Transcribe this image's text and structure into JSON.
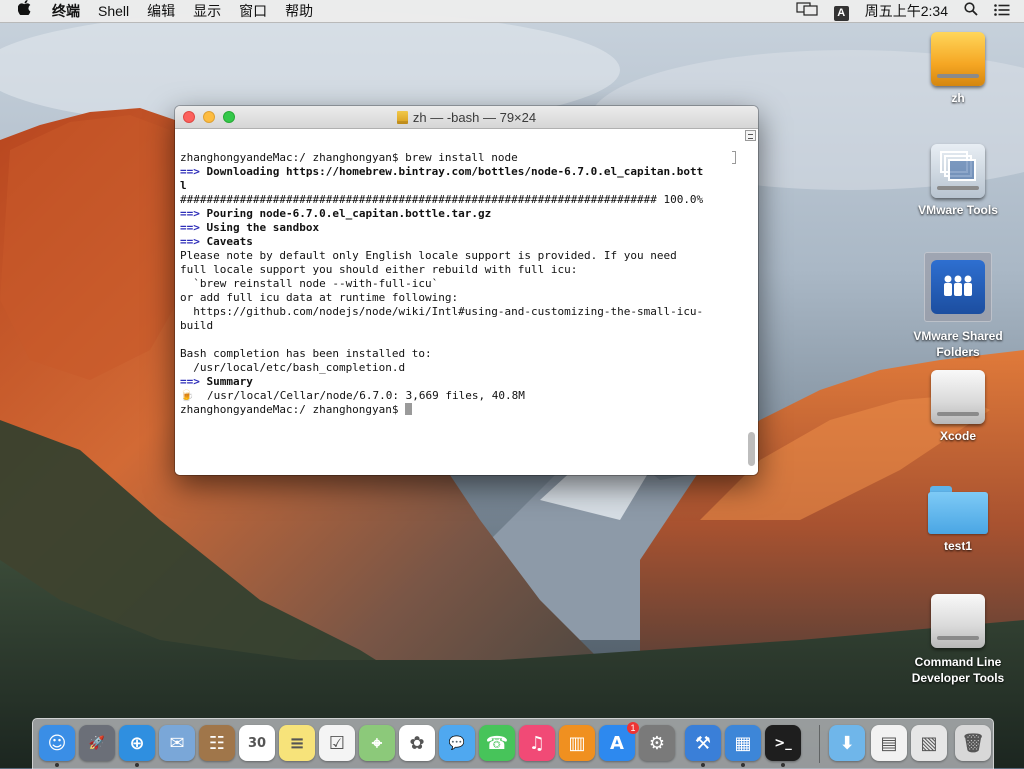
{
  "menubar": {
    "apple_icon": "apple-icon",
    "app_name": "终端",
    "menus": [
      "Shell",
      "编辑",
      "显示",
      "窗口",
      "帮助"
    ],
    "input_method": "A",
    "clock": "周五上午2:34"
  },
  "terminal": {
    "title": "zh — -bash — 79×24",
    "lines": [
      [
        {
          "t": "zhanghongyandeMac:/ zhanghongyan$ brew install node"
        }
      ],
      [
        {
          "t": "==>",
          "c": "arrow"
        },
        {
          "t": " Downloading https://homebrew.bintray.com/bottles/node-6.7.0.el_capitan.bott",
          "c": "b"
        }
      ],
      [
        {
          "t": "l",
          "c": "b"
        }
      ],
      [
        {
          "t": "######################################################################## 100.0%"
        }
      ],
      [
        {
          "t": "==>",
          "c": "arrow"
        },
        {
          "t": " Pouring node-6.7.0.el_capitan.bottle.tar.gz",
          "c": "b"
        }
      ],
      [
        {
          "t": "==>",
          "c": "arrow"
        },
        {
          "t": " Using the sandbox",
          "c": "b"
        }
      ],
      [
        {
          "t": "==>",
          "c": "arrow"
        },
        {
          "t": " Caveats",
          "c": "b"
        }
      ],
      [
        {
          "t": "Please note by default only English locale support is provided. If you need"
        }
      ],
      [
        {
          "t": "full locale support you should either rebuild with full icu:"
        }
      ],
      [
        {
          "t": "  `brew reinstall node --with-full-icu`"
        }
      ],
      [
        {
          "t": "or add full icu data at runtime following:"
        }
      ],
      [
        {
          "t": "  https://github.com/nodejs/node/wiki/Intl#using-and-customizing-the-small-icu-"
        }
      ],
      [
        {
          "t": "build"
        }
      ],
      [
        {
          "t": ""
        }
      ],
      [
        {
          "t": "Bash completion has been installed to:"
        }
      ],
      [
        {
          "t": "  /usr/local/etc/bash_completion.d"
        }
      ],
      [
        {
          "t": "==>",
          "c": "arrow"
        },
        {
          "t": " Summary",
          "c": "b"
        }
      ],
      [
        {
          "t": "🍺",
          "c": "beer"
        },
        {
          "t": "  /usr/local/Cellar/node/6.7.0: 3,669 files, 40.8M"
        }
      ],
      [
        {
          "t": "zhanghongyandeMac:/ zhanghongyan$ "
        },
        {
          "cursor": true
        }
      ]
    ]
  },
  "desktop_icons": [
    {
      "label": "zh",
      "kind": "hdd-orange"
    },
    {
      "label": "VMware Tools",
      "kind": "vm"
    },
    {
      "label_lines": [
        "VMware Shared",
        "Folders"
      ],
      "kind": "share",
      "selected": true
    },
    {
      "label": "Xcode",
      "kind": "hdd"
    },
    {
      "label": "test1",
      "kind": "folder"
    },
    {
      "label_lines": [
        "Command Line",
        "Developer Tools"
      ],
      "kind": "hdd"
    }
  ],
  "dock": {
    "items": [
      {
        "name": "finder-icon",
        "color": "#3a8ee6",
        "glyph": "☺",
        "running": true
      },
      {
        "name": "launchpad-icon",
        "color": "#6b6f78",
        "glyph": "🚀",
        "running": false
      },
      {
        "name": "safari-icon",
        "color": "#2f8fe0",
        "glyph": "⊕",
        "running": true
      },
      {
        "name": "mail-icon",
        "color": "#7aa7d8",
        "glyph": "✉",
        "running": false
      },
      {
        "name": "contacts-icon",
        "color": "#a0764a",
        "glyph": "☷",
        "running": false
      },
      {
        "name": "calendar-icon",
        "color": "#ffffff",
        "glyph": "30",
        "running": false
      },
      {
        "name": "notes-icon",
        "color": "#f7e37a",
        "glyph": "≡",
        "running": false
      },
      {
        "name": "reminders-icon",
        "color": "#f4f4f4",
        "glyph": "☑",
        "running": false
      },
      {
        "name": "maps-icon",
        "color": "#8cc97a",
        "glyph": "⌖",
        "running": false
      },
      {
        "name": "photos-icon",
        "color": "#ffffff",
        "glyph": "✿",
        "running": false
      },
      {
        "name": "messages-icon",
        "color": "#4fa8f0",
        "glyph": "💬",
        "running": false
      },
      {
        "name": "facetime-icon",
        "color": "#47c45a",
        "glyph": "☎",
        "running": false
      },
      {
        "name": "itunes-icon",
        "color": "#f14a76",
        "glyph": "♫",
        "running": false
      },
      {
        "name": "ibooks-icon",
        "color": "#f09020",
        "glyph": "▥",
        "running": false
      },
      {
        "name": "app-store-icon",
        "color": "#2d89ef",
        "glyph": "A",
        "running": false,
        "badge": "1"
      },
      {
        "name": "system-preferences-icon",
        "color": "#7a7a7a",
        "glyph": "⚙",
        "running": false
      },
      {
        "name": "xcode-icon",
        "color": "#3a7fd8",
        "glyph": "⚒",
        "running": true
      },
      {
        "name": "simulator-icon",
        "color": "#3d86d8",
        "glyph": "▦",
        "running": true
      },
      {
        "name": "terminal-icon",
        "color": "#1e1e1e",
        "glyph": ">_",
        "running": true
      },
      {
        "name": "downloads-stack-icon",
        "color": "#6fb6ea",
        "glyph": "⬇",
        "running": false
      },
      {
        "name": "documents-stack-icon",
        "color": "#f2f2f2",
        "glyph": "▤",
        "running": false
      },
      {
        "name": "screenshots-stack-icon",
        "color": "#e6e6e6",
        "glyph": "▧",
        "running": false
      },
      {
        "name": "trash-icon",
        "color": "#d8d8d8",
        "glyph": "🗑",
        "running": false
      }
    ]
  }
}
